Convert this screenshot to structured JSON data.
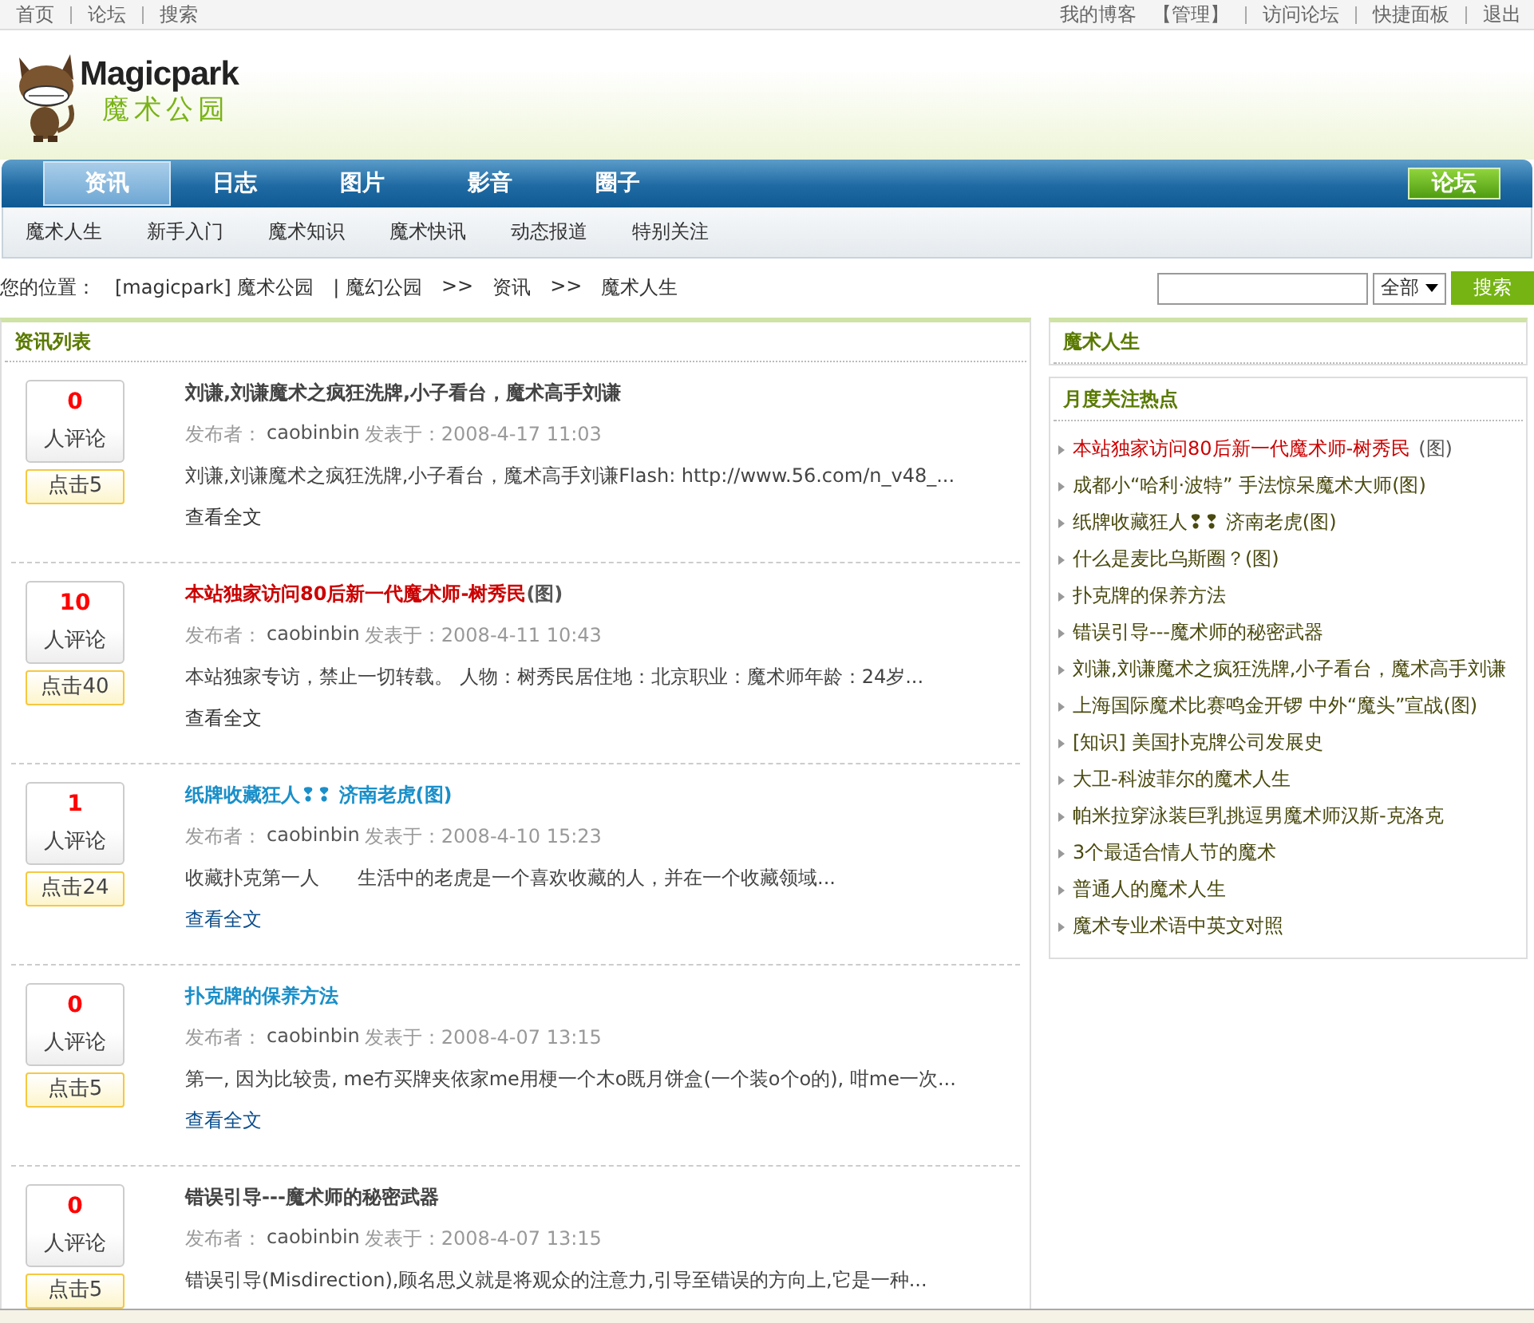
{
  "top_bar": {
    "left_links": [
      "首页",
      "论坛",
      "搜索"
    ],
    "right_links": [
      "我的博客",
      "【管理】",
      "访问论坛",
      "快捷面板",
      "退出"
    ]
  },
  "logo": {
    "name": "Magicpark",
    "subtitle": "魔术公园"
  },
  "nav": {
    "tabs": [
      {
        "label": "资讯",
        "selected": true
      },
      {
        "label": "日志",
        "selected": false
      },
      {
        "label": "图片",
        "selected": false
      },
      {
        "label": "影音",
        "selected": false
      },
      {
        "label": "圈子",
        "selected": false
      }
    ],
    "forum_button": "论坛"
  },
  "sub_nav": [
    "魔术人生",
    "新手入门",
    "魔术知识",
    "魔术快讯",
    "动态报道",
    "特别关注"
  ],
  "breadcrumb": {
    "label": "您的位置：",
    "parts": [
      "[magicpark] 魔术公园",
      "| 魔幻公园",
      ">>",
      "资讯",
      ">>",
      "魔术人生"
    ]
  },
  "search": {
    "scope": "全部",
    "button": "搜索"
  },
  "news_list": {
    "title": "资讯列表",
    "items": [
      {
        "comments": "0",
        "comments_label": "人评论",
        "clicks": "点击5",
        "title": "刘谦,刘谦魔术之疯狂洗牌,小子看台，魔术高手刘谦",
        "color": "#444444",
        "meta": "发布者：",
        "author": "caobinbin",
        "posted": "发表于：2008-4-17 11:03",
        "summary": "刘谦,刘谦魔术之疯狂洗牌,小子看台，魔术高手刘谦Flash: http://www.56.com/n_v48_...",
        "link": "查看全文",
        "visited": true
      },
      {
        "comments": "10",
        "comments_label": "人评论",
        "clicks": "点击40",
        "title": "本站独家访问80后新一代魔术师-树秀民",
        "suffix": "(图)",
        "color": "#cc0000",
        "meta": "发布者：",
        "author": "caobinbin",
        "posted": "发表于：2008-4-11 10:43",
        "summary": "本站独家专访，禁止一切转载。 人物：树秀民居住地：北京职业：魔术师年龄：24岁...",
        "link": "查看全文",
        "visited": true
      },
      {
        "comments": "1",
        "comments_label": "人评论",
        "clicks": "点击24",
        "title": "纸牌收藏狂人❢❢ 济南老虎(图)",
        "color": "#1a8fc9",
        "meta": "发布者：",
        "author": "caobinbin",
        "posted": "发表于：2008-4-10 15:23",
        "summary": "收藏扑克第一人　　生活中的老虎是一个喜欢收藏的人，并在一个收藏领域...",
        "link": "查看全文",
        "visited": false
      },
      {
        "comments": "0",
        "comments_label": "人评论",
        "clicks": "点击5",
        "title": "扑克牌的保养方法",
        "color": "#1a8fc9",
        "meta": "发布者：",
        "author": "caobinbin",
        "posted": "发表于：2008-4-07 13:15",
        "summary": "第一, 因为比较贵, me冇买牌夹依家me用梗一个木o既月饼盒(一个装o个o的), 咁me一次...",
        "link": "查看全文",
        "visited": false
      },
      {
        "comments": "0",
        "comments_label": "人评论",
        "clicks": "点击5",
        "title": "错误引导---魔术师的秘密武器",
        "color": "#444444",
        "meta": "发布者：",
        "author": "caobinbin",
        "posted": "发表于：2008-4-07 13:15",
        "summary": "错误引导(Misdirection),顾名思义就是将观众的注意力,引导至错误的方向上,它是一种..."
      }
    ]
  },
  "category_box": {
    "title": "魔术人生"
  },
  "hot_box": {
    "title": "月度关注热点",
    "items": [
      {
        "text": "本站独家访问80后新一代魔术师-树秀民",
        "suffix": "(图)",
        "highlight": true
      },
      {
        "text": "成都小“哈利·波特” 手法惊呆魔术大师(图)",
        "highlight": false
      },
      {
        "text": "纸牌收藏狂人❢❢ 济南老虎(图)",
        "highlight": false
      },
      {
        "text": "什么是麦比乌斯圈？(图)",
        "highlight": false
      },
      {
        "text": "扑克牌的保养方法",
        "highlight": false
      },
      {
        "text": "错误引导---魔术师的秘密武器",
        "highlight": false
      },
      {
        "text": "刘谦,刘谦魔术之疯狂洗牌,小子看台，魔术高手刘谦",
        "highlight": false
      },
      {
        "text": "上海国际魔术比赛鸣金开锣 中外“魔头”宣战(图)",
        "highlight": false
      },
      {
        "text": "[知识] 美国扑克牌公司发展史",
        "highlight": false
      },
      {
        "text": "大卫-科波菲尔的魔术人生",
        "highlight": false
      },
      {
        "text": "帕米拉穿泳装巨乳挑逗男魔术师汉斯-克洛克",
        "highlight": false
      },
      {
        "text": "3个最适合情人节的魔术",
        "highlight": false
      },
      {
        "text": "普通人的魔术人生",
        "highlight": false
      },
      {
        "text": "魔术专业术语中英文对照",
        "highlight": false
      }
    ]
  }
}
